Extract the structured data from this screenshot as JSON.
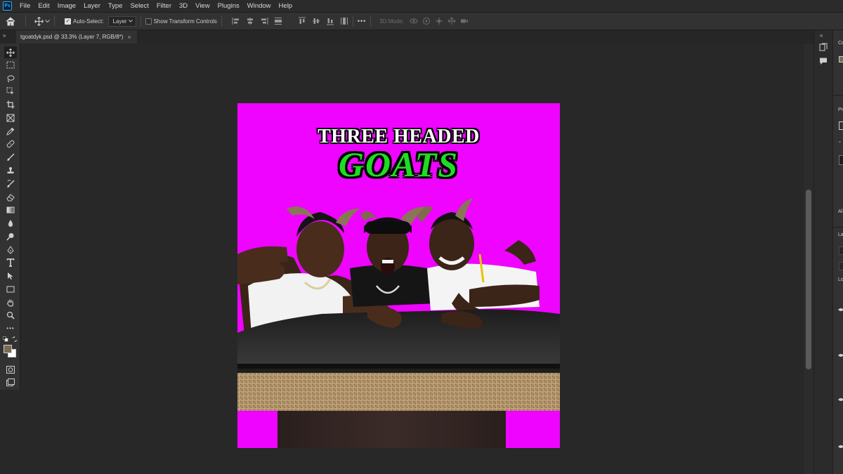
{
  "app": {
    "logo": "Ps"
  },
  "menu": [
    "File",
    "Edit",
    "Image",
    "Layer",
    "Type",
    "Select",
    "Filter",
    "3D",
    "View",
    "Plugins",
    "Window",
    "Help"
  ],
  "options": {
    "auto_select_label": "Auto-Select:",
    "auto_select_value": "Layer",
    "show_transform_label": "Show Transform Controls",
    "mode_3d_label": "3D Mode:",
    "more_label": "•••"
  },
  "document": {
    "tab_label": "tgoatdyk.psd @ 33.3% (Layer 7, RGB/8*)",
    "close_glyph": "×"
  },
  "artwork": {
    "line1": "THREE HEADED",
    "line2": "GOATS",
    "background_color": "#ee04ff",
    "title_green": "#1fdc22"
  },
  "right_panel": {
    "labels": [
      "Co",
      "Pr",
      "Al",
      "La",
      "Lo"
    ]
  },
  "colors": {
    "foreground": "#7b6b55",
    "background": "#ffffff",
    "canvas_bg": "#282828",
    "ui_panel": "#323232"
  }
}
